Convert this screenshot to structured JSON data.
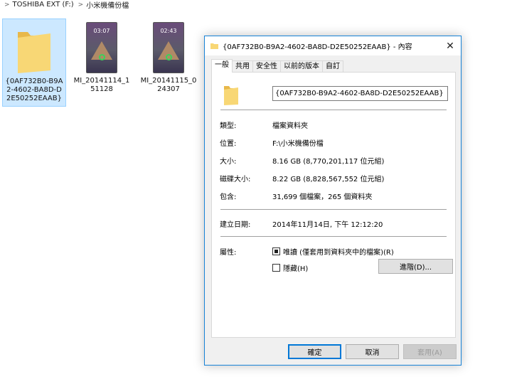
{
  "breadcrumb": {
    "items": [
      "TOSHIBA EXT (F:)",
      "小米機備份檔"
    ]
  },
  "files": [
    {
      "name": "{0AF732B0-B9A2-4602-BA8D-D2E50252EAAB}",
      "caption_lines": [
        "{0AF732B0-B9A",
        "2-4602-BA8D-D",
        "2E50252EAAB}"
      ],
      "type": "folder",
      "selected": true
    },
    {
      "name": "MI_20141114_151128",
      "caption_lines": [
        "MI_20141114_1",
        "51128"
      ],
      "type": "screenshot",
      "clock": "03:07"
    },
    {
      "name": "MI_20141115_024307",
      "caption_lines": [
        "MI_20141115_0",
        "24307"
      ],
      "type": "screenshot",
      "clock": "02:43"
    }
  ],
  "dialog": {
    "title": "{0AF732B0-B9A2-4602-BA8D-D2E50252EAAB} - 內容",
    "tabs": [
      "一般",
      "共用",
      "安全性",
      "以前的版本",
      "自訂"
    ],
    "active_tab": "一般",
    "name_value": "{0AF732B0-B9A2-4602-BA8D-D2E50252EAAB}",
    "props": {
      "type_label": "類型:",
      "type_value": "檔案資料夾",
      "location_label": "位置:",
      "location_value": "F:\\小米機備份檔",
      "size_label": "大小:",
      "size_value": "8.16 GB (8,770,201,117 位元組)",
      "disk_size_label": "磁碟大小:",
      "disk_size_value": "8.22 GB (8,828,567,552 位元組)",
      "contains_label": "包含:",
      "contains_value": "31,699 個檔案，265 個資料夾",
      "created_label": "建立日期:",
      "created_value": "2014年11月14日, 下午 12:12:20",
      "attributes_label": "屬性:"
    },
    "attributes": {
      "readonly_label": "唯讀 (僅套用到資料夾中的檔案)(R)",
      "readonly_state": "indeterminate",
      "hidden_label": "隱藏(H)",
      "hidden_state": "unchecked",
      "advanced_button": "進階(D)..."
    },
    "buttons": {
      "ok": "確定",
      "cancel": "取消",
      "apply": "套用(A)"
    }
  },
  "colors": {
    "accent": "#0078d7",
    "folder": "#f8d775",
    "selection": "#cce8ff"
  }
}
